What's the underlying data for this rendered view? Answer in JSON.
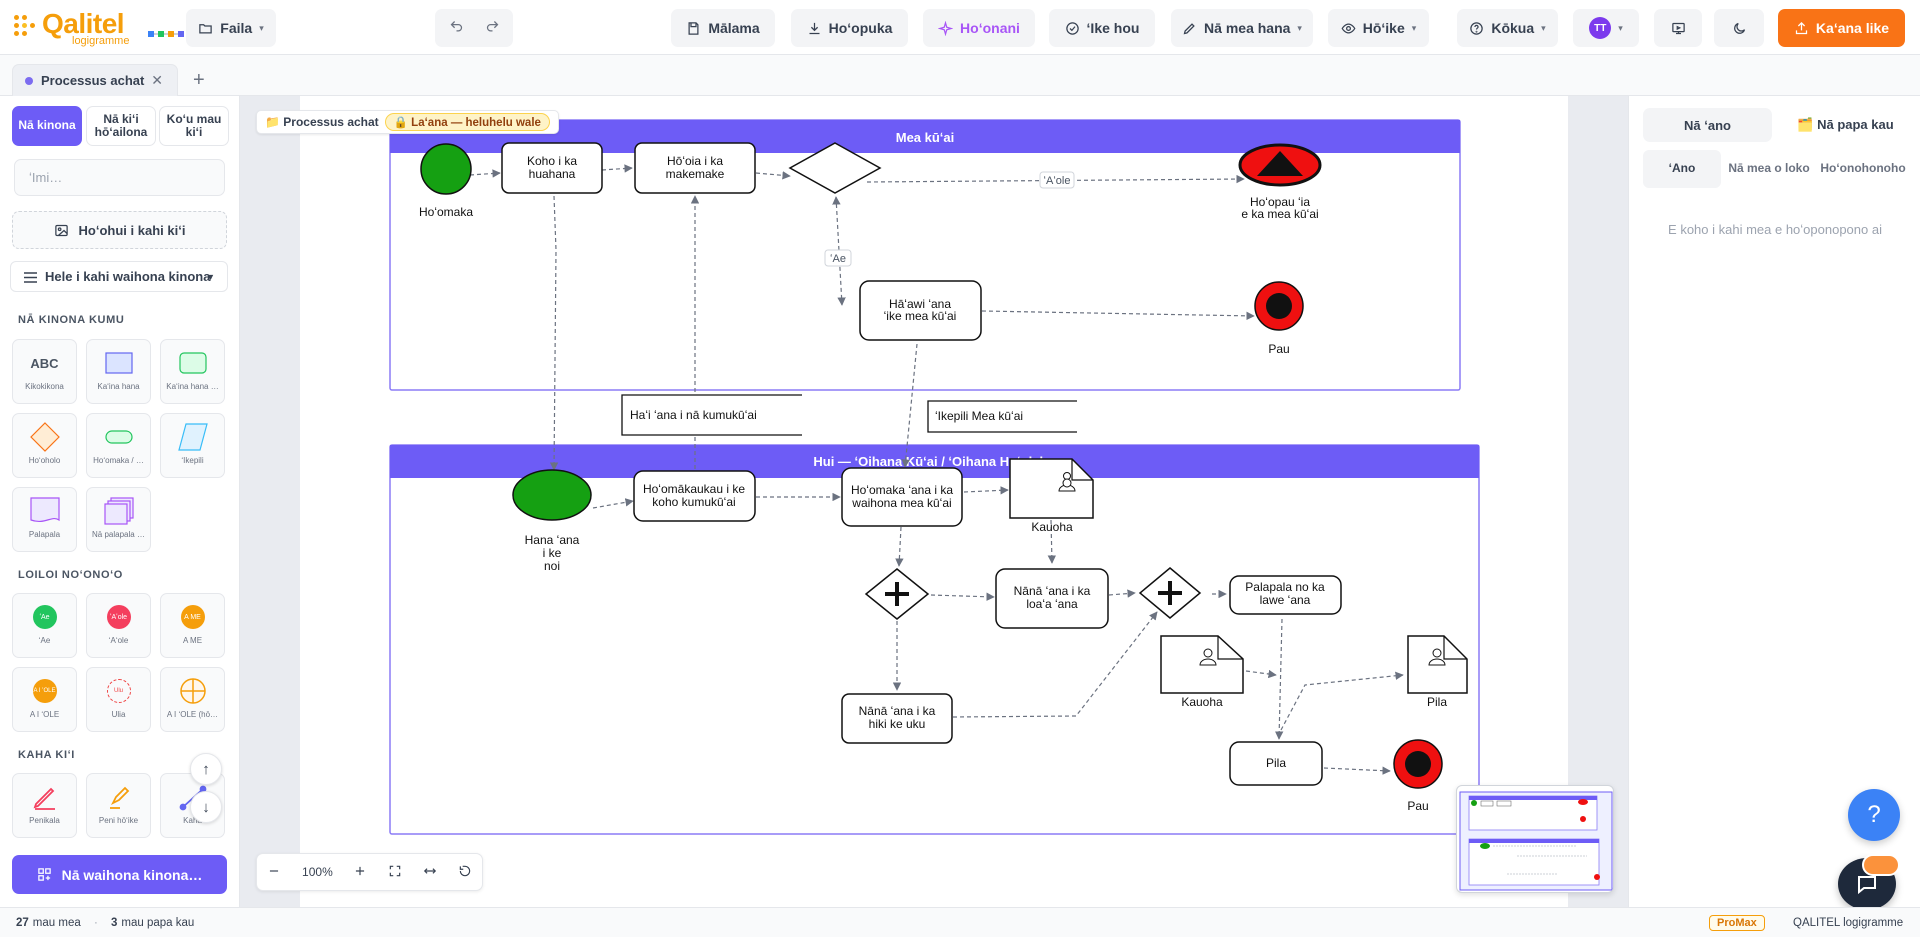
{
  "header": {
    "logo_text": "Qalitel",
    "logo_sub": "logigramme",
    "file_menu": "Faila",
    "save": "Mālama",
    "download": "Hoʻopuka",
    "ai": "Hoʻonani",
    "validate": "ʻIke hou",
    "edit": "Nā mea hana",
    "view": "Hōʻike",
    "help": "Kōkua",
    "avatar_initials": "TT",
    "share": "Kaʻana like"
  },
  "tabs": {
    "items": [
      {
        "label": "Processus achat"
      }
    ],
    "add": "+"
  },
  "sidebar": {
    "segments": [
      "Nā kinona",
      "Nā kiʻi hōʻailona",
      "Koʻu mau kiʻi"
    ],
    "search_placeholder": "ʻImi…",
    "import_label": "Hoʻohui i kahi kiʻi",
    "library_select": "Hele i kahi waihona kinona",
    "sections": {
      "basic": "NĀ KINONA KUMU",
      "state": "LOILOI NOʻONOʻO",
      "draw": "KAHA KIʻI"
    },
    "basic_shapes": [
      {
        "label": "Kikokikona",
        "glyph": "ABC"
      },
      {
        "label": "Kaʻina hana"
      },
      {
        "label": "Kaʻina hana …"
      },
      {
        "label": "Hoʻoholo"
      },
      {
        "label": "Hoʻomaka / …"
      },
      {
        "label": "ʻIkepili"
      },
      {
        "label": "Palapala"
      },
      {
        "label": "Nā palapala …"
      }
    ],
    "state_shapes": [
      {
        "label": "ʻAe",
        "glyph": "ʻAe",
        "color": "#22c55e"
      },
      {
        "label": "ʻAʻole",
        "glyph": "ʻAʻole",
        "color": "#f43f5e"
      },
      {
        "label": "A ME",
        "glyph": "A ME",
        "color": "#f59e0b"
      },
      {
        "label": "A I ʻOLE",
        "glyph": "A I ʻOLE",
        "color": "#f59e0b"
      },
      {
        "label": "Ulia",
        "glyph": "Ulu",
        "color": "#ef4444"
      },
      {
        "label": "A I ʻOLE (hō…",
        "color": "#f59e0b"
      }
    ],
    "draw_tools": [
      {
        "label": "Penikala"
      },
      {
        "label": "Peni hōʻike"
      },
      {
        "label": "Kaha"
      }
    ],
    "scroll_up": "↑",
    "scroll_down": "↓",
    "library_button": "Nā waihona kinona…"
  },
  "canvas": {
    "breadcrumb": "📁 Processus achat",
    "lock_badge": "🔒 Laʻana — heluhelu wale",
    "zoom": "100%",
    "pool1": {
      "title": "Mea kūʻai",
      "start_label": "Hoʻomaka",
      "task_choose": "Koho i ka huahana",
      "task_check": "Hōʻoia i ka makemake",
      "edge_no": "ʻAʻole",
      "edge_yes": "ʻAe",
      "end_cancel_label_1": "Hoʻopau ʻia",
      "end_cancel_label_2": "e ka mea kūʻai",
      "task_send_1": "Hāʻawi ʻana",
      "task_send_2": "ʻike mea kūʻai",
      "end_label": "Pau"
    },
    "data_info": "Haʻi ʻana i nā kumukūʻai",
    "data_client": "ʻIkepili Mea kūʻai",
    "pool2": {
      "title": "Hui — ʻOihana Kūʻai / ʻOihana Hoʻolako",
      "start_label_1": "Hana ʻana",
      "start_label_2": "i ke",
      "start_label_3": "noi",
      "task_prepare_1": "Hoʻomākaukau i ke",
      "task_prepare_2": "koho kumukūʻai",
      "task_db_1": "Hoʻomaka ʻana i ka",
      "task_db_2": "waihona mea kūʻai",
      "doc_order": "Kauoha",
      "task_check_price_1": "Nānā ʻana i ka",
      "task_check_price_2": "loaʻa ʻana",
      "task_invoice_1": "Palapala no ka",
      "task_invoice_2": "lawe ʻana",
      "doc_order2": "Kauoha",
      "doc_bill": "Pila",
      "task_check_stock_1": "Nānā ʻana i ka",
      "task_check_stock_2": "hiki ke uku",
      "task_bill": "Pila",
      "end_label": "Pau"
    }
  },
  "right_panel": {
    "tab_properties": "Nā ʻano",
    "tab_layers": "🗂️ Nā papa kau",
    "sub_style": "ʻAno",
    "sub_props": "Nā mea o loko",
    "sub_layout": "Hoʻonohonoho",
    "empty": "E koho i kahi mea e hoʻoponopono ai"
  },
  "fab": {
    "help": "?"
  },
  "status": {
    "elements_count": "27",
    "elements_label": "mau mea",
    "layers_count": "3",
    "layers_label": "mau papa kau",
    "plan": "ProMax",
    "brand": "QALITEL logigramme"
  },
  "colors": {
    "accent": "#6d5cf6",
    "pool": "#6d5cf6",
    "start": "#15a012",
    "end": "#ef1010",
    "share": "#f97316"
  }
}
